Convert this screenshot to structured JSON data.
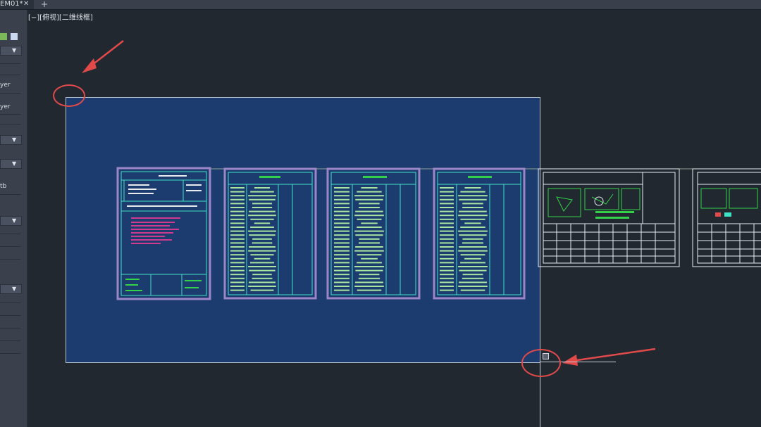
{
  "tabbar": {
    "tab_label": "EM01*",
    "close_glyph": "✕",
    "add_glyph": "+"
  },
  "view_label": "[−][俯视][二维线框]",
  "sidebar": {
    "labels": [
      "yer",
      "yer",
      "tb"
    ]
  },
  "icons": {
    "close": "close-icon",
    "add": "plus-icon",
    "dropdown": "chevron-down-icon"
  },
  "colors": {
    "canvas": "#212830",
    "selection_fill": "#1c3b6e",
    "annotation_red": "#e24a4a",
    "drawing_cyan": "#3fe0c6",
    "drawing_green": "#34d14a",
    "drawing_white": "#e8ecef",
    "drawing_magenta": "#d03a8e",
    "frame_purple": "#9b87c8"
  }
}
